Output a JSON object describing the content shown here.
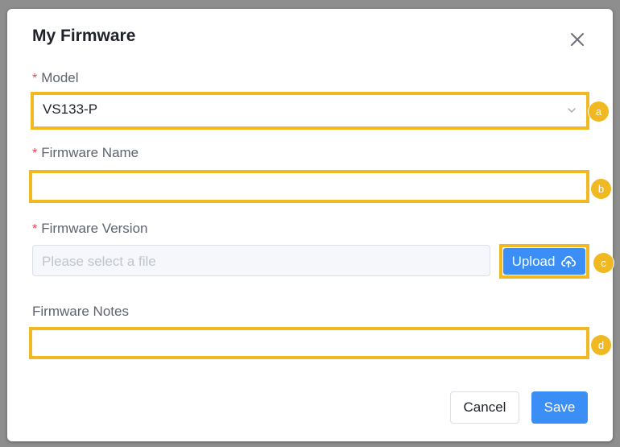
{
  "dialog": {
    "title": "My Firmware",
    "close_icon": "close-icon"
  },
  "fields": {
    "model": {
      "required_mark": "*",
      "label": "Model",
      "value": "VS133-P",
      "icon": "chevron-down-icon"
    },
    "firmware_name": {
      "required_mark": "*",
      "label": "Firmware Name",
      "value": ""
    },
    "firmware_version": {
      "required_mark": "*",
      "label": "Firmware Version",
      "placeholder": "Please select a file",
      "upload_label": "Upload",
      "upload_icon": "cloud-upload-icon"
    },
    "firmware_notes": {
      "label": "Firmware Notes",
      "value": ""
    }
  },
  "annotations": [
    "a",
    "b",
    "c",
    "d"
  ],
  "footer": {
    "cancel_label": "Cancel",
    "save_label": "Save"
  },
  "colors": {
    "highlight": "#f0b921",
    "primary": "#3a8ef6",
    "required": "#e5484d"
  }
}
